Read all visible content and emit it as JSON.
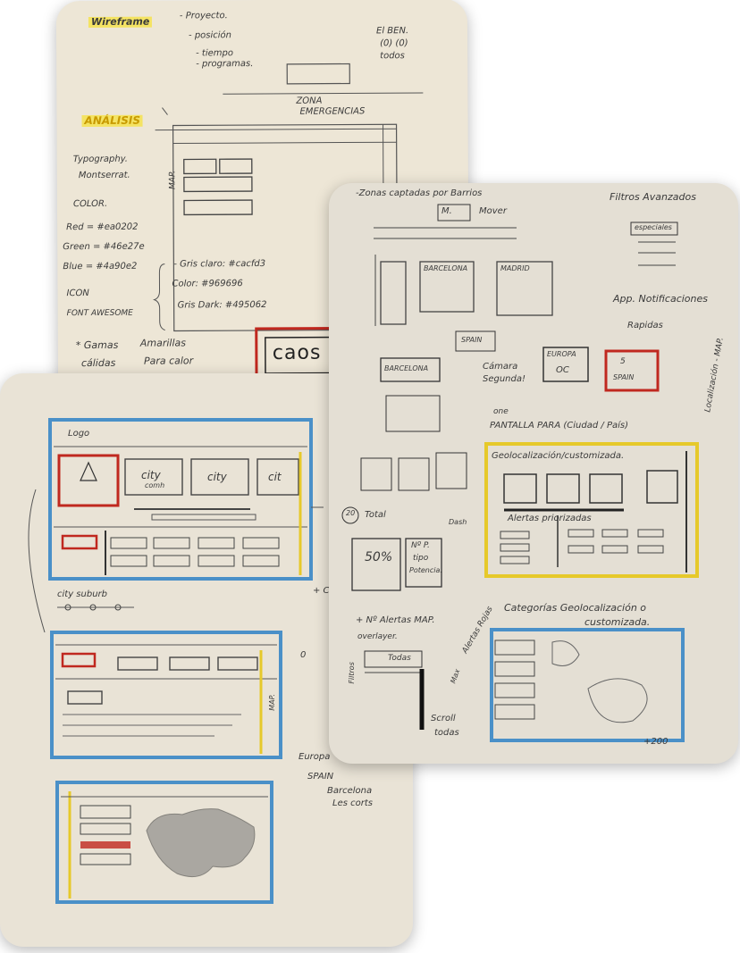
{
  "sheet_top": {
    "title": "Wireframe",
    "project_notes": [
      "- Proyecto.",
      "- posición",
      "- tiempo",
      "- programas."
    ],
    "corner_note": [
      "El BEN.",
      "(0) (0)",
      "todos"
    ],
    "zones_label": [
      "ZONA",
      "EMERGENCIAS"
    ],
    "analysis_title": "ANÁLISIS",
    "typography": [
      "Typography.",
      "Montserrat."
    ],
    "color_label": "COLOR.",
    "colors": [
      {
        "label": "Red = #ea0202",
        "hex": "#ea0202"
      },
      {
        "label": "Green = #46e27e",
        "hex": "#46e27e"
      },
      {
        "label": "Blue = #4a90e2",
        "hex": "#4a90e2"
      }
    ],
    "greys": [
      {
        "label": "- Gris claro: #cacfd3",
        "hex": "#cacfd3"
      },
      {
        "label": "Color: #969696",
        "hex": "#969696"
      },
      {
        "label": "Gris Dark: #495062",
        "hex": "#495062"
      }
    ],
    "icon_label": "ICON",
    "icon_font": "FONT AWESOME",
    "gamas_note": [
      "* Gamas",
      "Amarillas",
      "cálidas",
      "Para calor"
    ],
    "map_label": "MAP.",
    "caos_label": "caos"
  },
  "sheet_left": {
    "logo": "Logo",
    "cities": [
      "city",
      "city",
      "cit"
    ],
    "city_sub": "comh",
    "slider_label": "city suburb",
    "map_label": "MAP.",
    "europe_tree": [
      "Europa",
      "SPAIN",
      "Barcelona",
      "Les corts"
    ],
    "plus_c": "+ C",
    "zero": "0"
  },
  "sheet_right": {
    "heading": "-Zonas captadas por Barrios",
    "move_label": "M.",
    "move_text": "Mover",
    "filters_title": "Filtros Avanzados",
    "filters_item": "especiales",
    "app_notice": "App. Notificaciones",
    "rapidas": "Rapidas",
    "geo_map_vertical": "Localización - MAP.",
    "barcelona_card": "BARCELONA",
    "madrid_card": "MADRID",
    "spain_label": "SPAIN",
    "camara_label": [
      "Cámara",
      "Segunda!"
    ],
    "europa_label": "EUROPA",
    "europa_sub": "OC",
    "spain_red": "SPAIN",
    "spain_red_num": "5",
    "barcelona_box": "BARCELONA",
    "pantalla_note": [
      "one",
      "PANTALLA PARA (Ciudad / País)"
    ],
    "geo_title": "Geolocalización/customizada.",
    "alertas_priorizadas": "Alertas priorizadas",
    "dash_label": "Dash",
    "total_num": "20",
    "total_label": "Total",
    "percent": "50%",
    "np_box": [
      "Nº P.",
      "tipo",
      "Potencia."
    ],
    "alertas_note": "+ Nº Alertas MAP.",
    "overlayer": "overlayer.",
    "filtros_side": "Filtros",
    "todas_label": "Todas",
    "alertas_roja": "Alertas Rojas",
    "categorias": [
      "Categorías Geolocalización o",
      "customizada."
    ],
    "scroll_todas": [
      "Scroll",
      "todas"
    ],
    "plus_200": "+200",
    "max_label": "Max"
  }
}
